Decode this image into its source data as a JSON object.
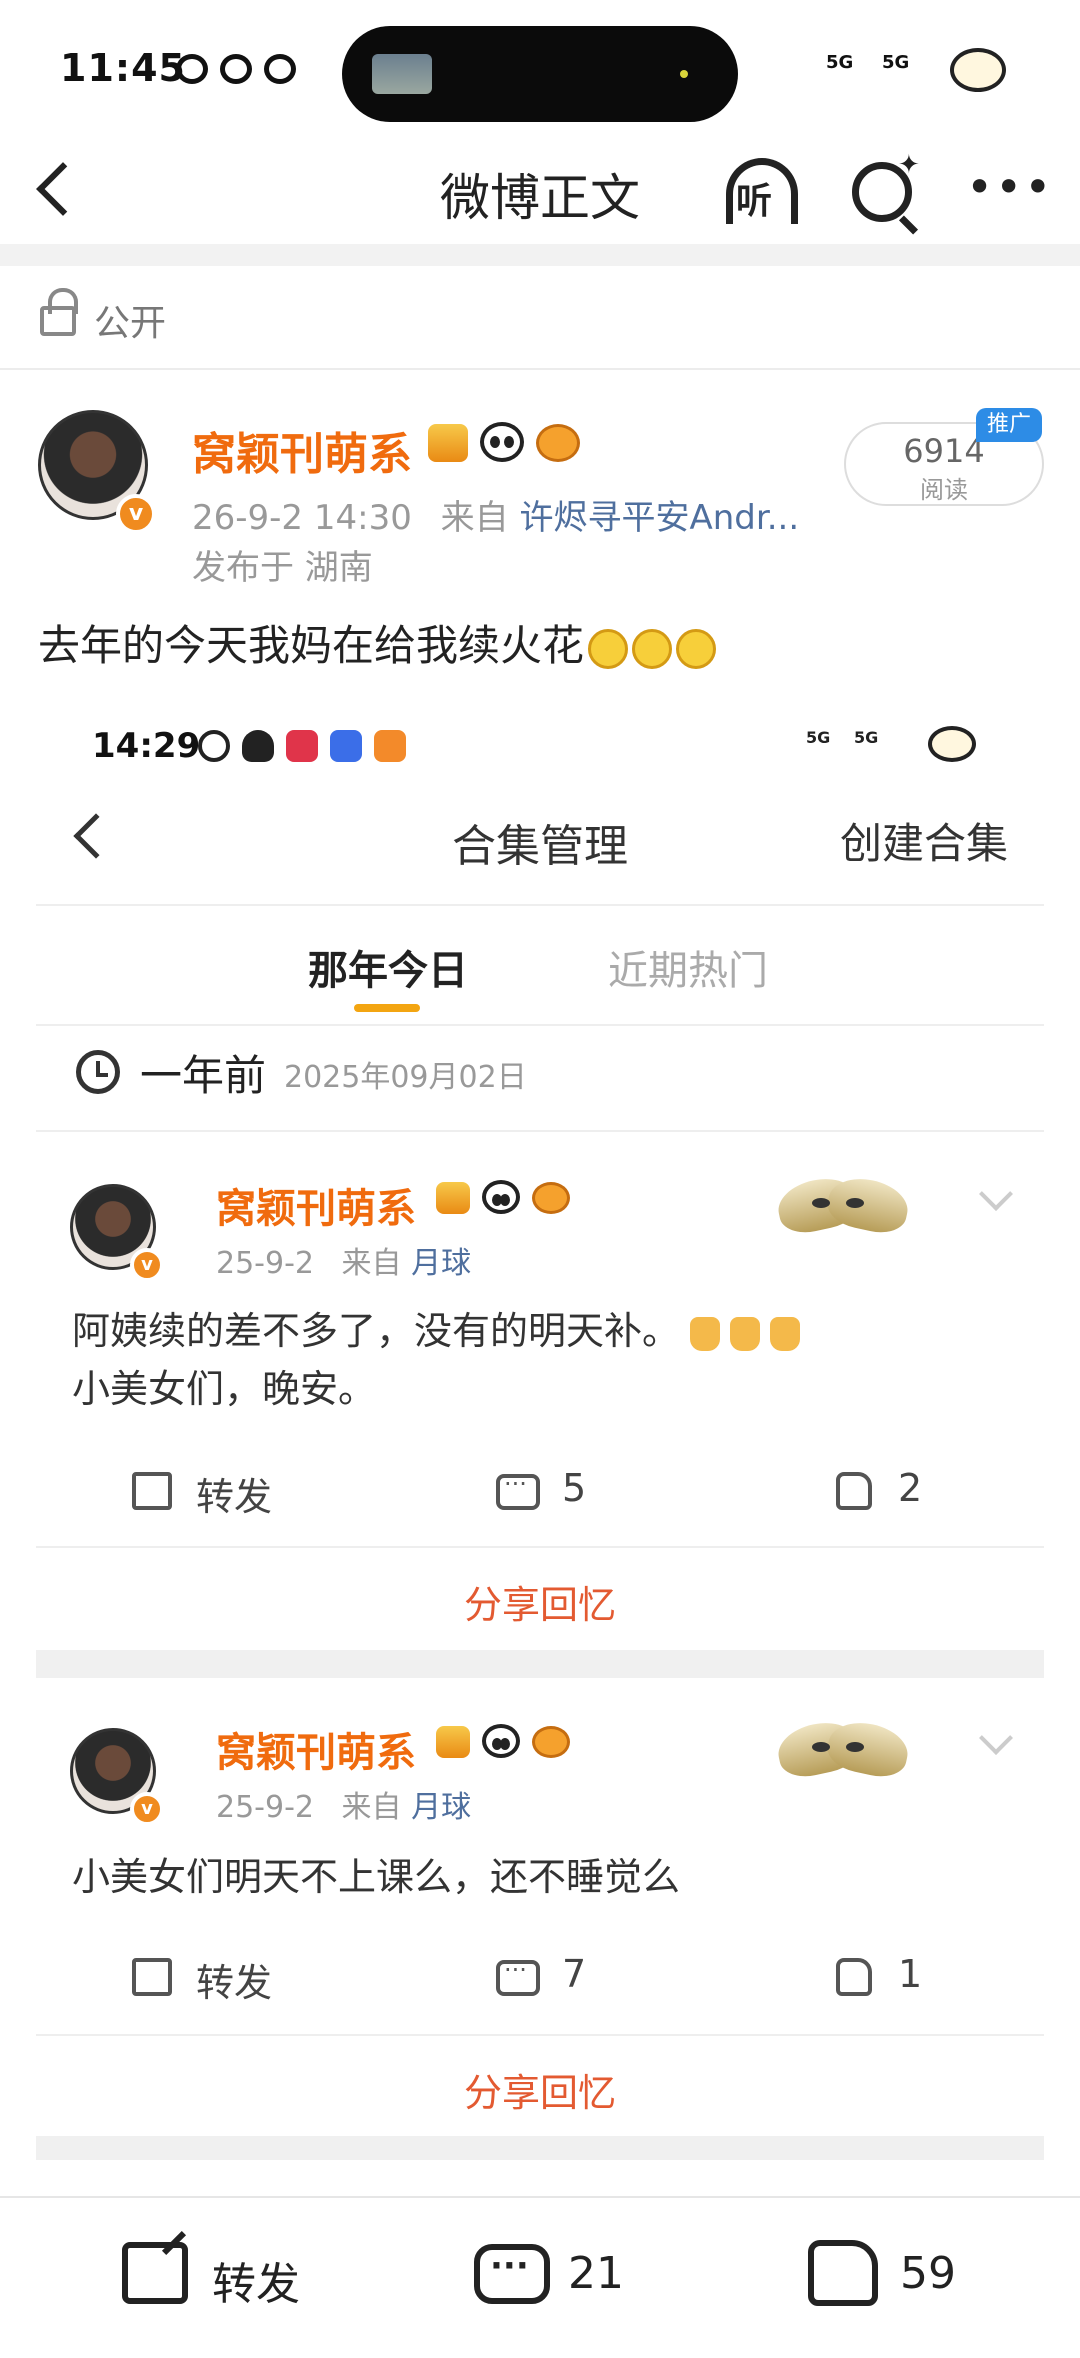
{
  "status_bar": {
    "time": "11:45",
    "signal1": "5G",
    "signal2": "5G"
  },
  "nav": {
    "title": "微博正文",
    "listen_label": "听"
  },
  "visibility": {
    "label": "公开"
  },
  "post": {
    "username": "窝颖刊萌系",
    "datetime": "26-9-2 14:30",
    "source_prefix": "来自",
    "source": "许烬寻平安Andr...",
    "location": "发布于 湖南",
    "read_count": "6914",
    "read_label": "阅读",
    "promo_label": "推广",
    "text": "去年的今天我妈在给我续火花"
  },
  "embedded": {
    "time": "14:29",
    "signal1": "5G",
    "signal2": "5G",
    "title": "合集管理",
    "create_label": "创建合集",
    "tabs": [
      "那年今日",
      "近期热门"
    ],
    "active_tab": "那年今日",
    "ago": "一年前",
    "date": "2025年09月02日",
    "cards": [
      {
        "username": "窝颖刊萌系",
        "date": "25-9-2",
        "source_prefix": "来自",
        "source": "月球",
        "line1": "阿姨续的差不多了，没有的明天补。",
        "line2": "小美女们，晚安。",
        "repost_label": "转发",
        "comments": "5",
        "likes": "2",
        "share_label": "分享回忆"
      },
      {
        "username": "窝颖刊萌系",
        "date": "25-9-2",
        "source_prefix": "来自",
        "source": "月球",
        "line1": "小美女们明天不上课么，还不睡觉么",
        "repost_label": "转发",
        "comments": "7",
        "likes": "1",
        "share_label": "分享回忆"
      }
    ]
  },
  "bottom_bar": {
    "repost_label": "转发",
    "comments": "21",
    "likes": "59"
  },
  "colors": {
    "username": "#f06b0e",
    "share": "#e35a31",
    "promo": "#2d8ce6",
    "tab_indicator": "#f3a511",
    "source_link": "#4f6f9e"
  }
}
